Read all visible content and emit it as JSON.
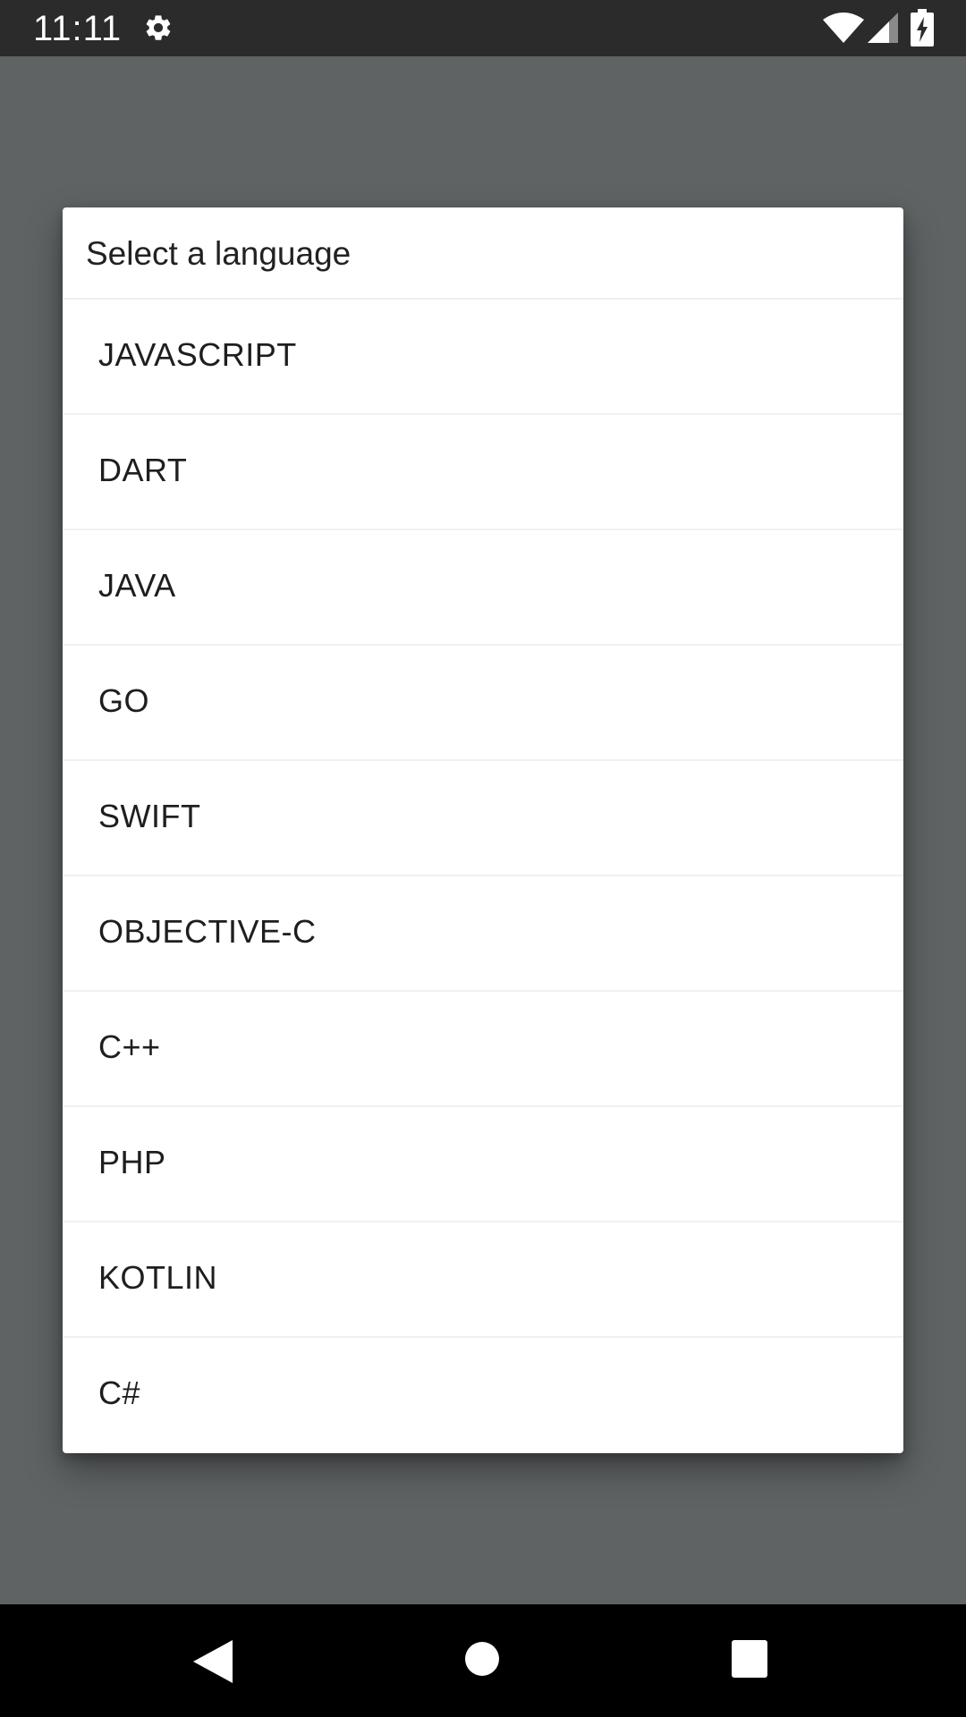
{
  "status_bar": {
    "time": "11:11",
    "icons": [
      "settings-icon",
      "wifi-icon",
      "cellular-signal-icon",
      "battery-charging-icon"
    ]
  },
  "dialog": {
    "title": "Select a language",
    "options": [
      {
        "label": "JAVASCRIPT"
      },
      {
        "label": "DART"
      },
      {
        "label": "JAVA"
      },
      {
        "label": "GO"
      },
      {
        "label": "SWIFT"
      },
      {
        "label": "OBJECTIVE-C"
      },
      {
        "label": "C++"
      },
      {
        "label": "PHP"
      },
      {
        "label": "KOTLIN"
      },
      {
        "label": "C#"
      }
    ]
  },
  "nav_bar": {
    "icons": [
      "back-icon",
      "home-icon",
      "recents-icon"
    ]
  },
  "colors": {
    "status_bar_bg": "#2b2b2b",
    "scrim": "#5f6364",
    "dialog_bg": "#ffffff",
    "text": "#1e1e1e",
    "nav_bar_bg": "#000000"
  }
}
